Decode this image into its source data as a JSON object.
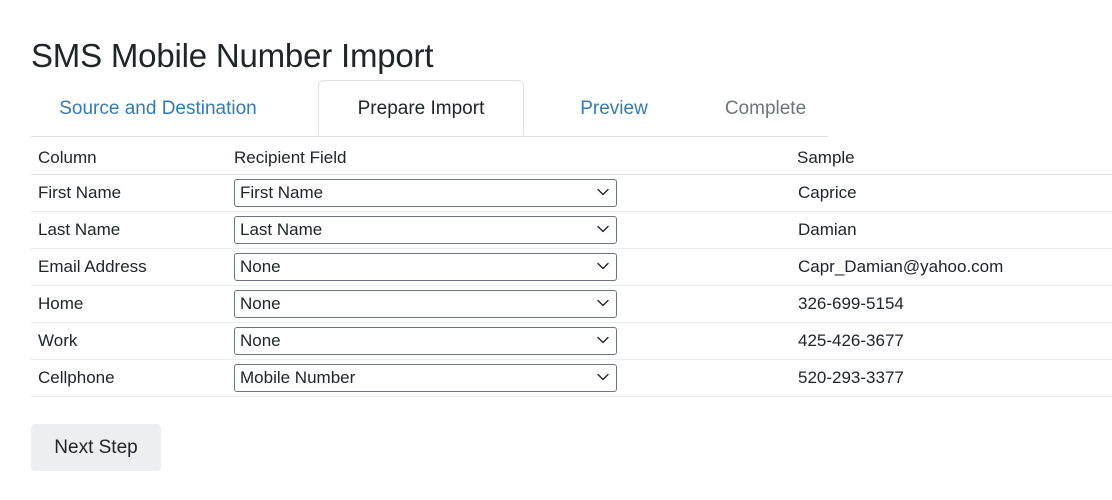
{
  "page": {
    "title": "SMS Mobile Number Import"
  },
  "tabs": [
    {
      "label": "Source and Destination",
      "state": "link"
    },
    {
      "label": "Prepare Import",
      "state": "active"
    },
    {
      "label": "Preview",
      "state": "link"
    },
    {
      "label": "Complete",
      "state": "disabled"
    }
  ],
  "table": {
    "headers": {
      "column": "Column",
      "field": "Recipient Field",
      "sample": "Sample"
    },
    "rows": [
      {
        "column": "First Name",
        "field": "First Name",
        "sample": "Caprice"
      },
      {
        "column": "Last Name",
        "field": "Last Name",
        "sample": "Damian"
      },
      {
        "column": "Email Address",
        "field": "None",
        "sample": "Capr_Damian@yahoo.com"
      },
      {
        "column": "Home",
        "field": "None",
        "sample": "326-699-5154"
      },
      {
        "column": "Work",
        "field": "None",
        "sample": "425-426-3677"
      },
      {
        "column": "Cellphone",
        "field": "Mobile Number",
        "sample": "520-293-3377"
      }
    ]
  },
  "footer": {
    "next_label": "Next Step"
  },
  "icons": {
    "chevron_down": "chevron-down-icon"
  },
  "colors": {
    "link": "#337ab7",
    "muted": "#6c757d",
    "text": "#212529",
    "border": "#dee2e6",
    "row_border": "#e9ecef",
    "button_bg": "#eceef0"
  }
}
